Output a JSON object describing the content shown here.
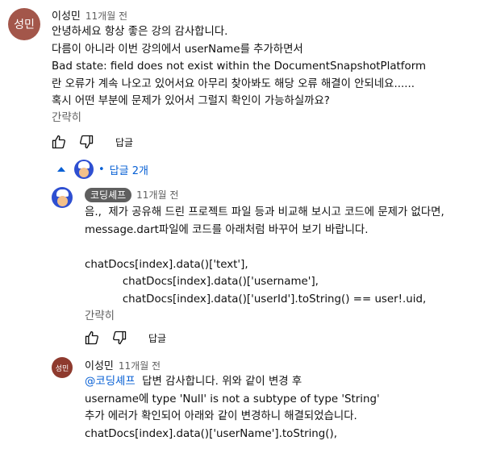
{
  "comment": {
    "avatar_text": "성민",
    "author": "이성민",
    "time": "11개월 전",
    "lines": [
      "안녕하세요 항상 좋은 강의 감사합니다.",
      "다름이 아니라 이번 강의에서 userName를 추가하면서",
      "Bad state: field does not exist within the DocumentSnapshotPlatform",
      "란 오류가 계속 나오고 있어서요 아무리 찾아봐도 해당 오류 해결이 안되네요......",
      "혹시 어떤 부분에 문제가 있어서 그럴지 확인이 가능하실까요?"
    ],
    "less_label": "간략히",
    "reply_label": "답글"
  },
  "replies_toggle": {
    "label": "답글 2개",
    "bullet": "•"
  },
  "reply1": {
    "author": "코딩셰프",
    "time": "11개월 전",
    "lines": [
      "음.,  제가 공유해 드린 프로젝트 파일 등과 비교해 보시고 코드에 문제가 없다면,",
      "message.dart파일에 코드를 아래처럼 바꾸어 보기 바랍니다.",
      "",
      "chatDocs[index].data()['text'],",
      "           chatDocs[index].data()['username'],",
      "           chatDocs[index].data()['userId'].toString() == user!.uid,"
    ],
    "less_label": "간략히",
    "reply_label": "답글"
  },
  "reply2": {
    "avatar_text": "성민",
    "author": "이성민",
    "time": "11개월 전",
    "mention": "@코딩셰프",
    "first_line_rest": "  답변 감사합니다. 위와 같이 변경 후",
    "lines": [
      "username에 type 'Null' is not a subtype of type 'String'",
      "추가 에러가 확인되어 아래와 같이 변경하니 해결되었습니다.",
      "chatDocs[index].data()['userName'].toString(),"
    ]
  },
  "colors": {
    "avatar_bg": "#a3564a",
    "avatar_bg_small": "#8e3a2e",
    "link_blue": "#065fd4",
    "chip_bg": "#5f5f5f"
  },
  "icons": [
    "like-icon",
    "dislike-icon",
    "caret-up-icon",
    "chef-avatar-icon"
  ]
}
